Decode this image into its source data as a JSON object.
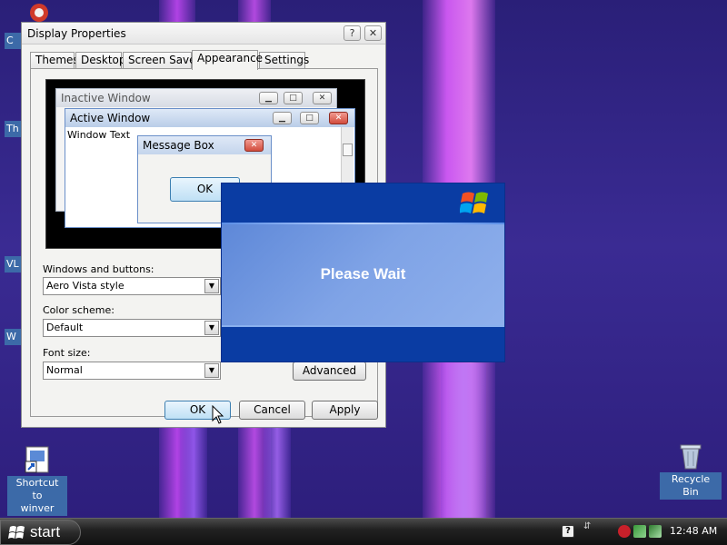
{
  "window": {
    "title": "Display Properties",
    "help_btn": "?",
    "close_btn": "✕",
    "tabs": [
      "Themes",
      "Desktop",
      "Screen Saver",
      "Appearance",
      "Settings"
    ],
    "active_tab": "Appearance"
  },
  "preview": {
    "inactive_title": "Inactive Window",
    "active_title": "Active Window",
    "window_text": "Window Text",
    "msgbox_title": "Message Box",
    "msgbox_ok": "OK"
  },
  "form": {
    "windows_buttons_label": "Windows and buttons:",
    "windows_buttons_value": "Aero Vista style",
    "color_scheme_label": "Color scheme:",
    "color_scheme_value": "Default",
    "font_size_label": "Font size:",
    "font_size_value": "Normal",
    "advanced_label": "Advanced"
  },
  "buttons": {
    "ok": "OK",
    "cancel": "Cancel",
    "apply": "Apply"
  },
  "wait_dialog": {
    "text": "Please Wait"
  },
  "desktop": {
    "icons": [
      {
        "name": "shortcut-to-winver",
        "label_line1": "Shortcut to",
        "label_line2": "winver"
      },
      {
        "name": "recycle-bin",
        "label_line1": "Recycle Bin"
      }
    ],
    "edge_labels": [
      "C",
      "Th",
      "VL",
      "W"
    ]
  },
  "taskbar": {
    "start_label": "start",
    "clock": "12:48 AM"
  },
  "colors": {
    "desktop_bg": "#2a1f78",
    "wait_blue": "#0a3ca3",
    "taskbar": "#1a1a1a"
  }
}
